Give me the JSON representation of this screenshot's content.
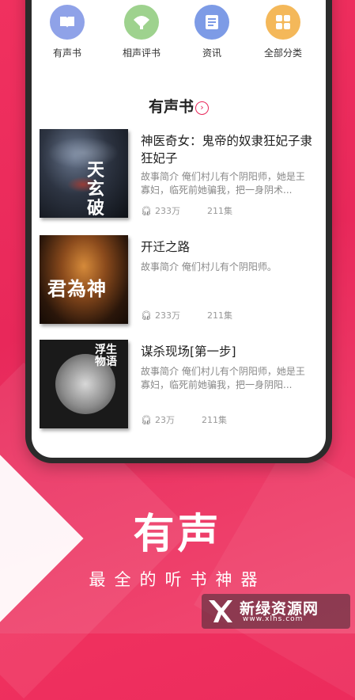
{
  "categories": [
    {
      "label": "有声书",
      "icon": "book-icon",
      "color": "#8fa2e8"
    },
    {
      "label": "相声评书",
      "icon": "fan-icon",
      "color": "#9ed28e"
    },
    {
      "label": "资讯",
      "icon": "news-icon",
      "color": "#7d9be6"
    },
    {
      "label": "全部分类",
      "icon": "grid-icon",
      "color": "#f4b85a"
    }
  ],
  "section": {
    "title": "有声书",
    "more_icon": "chevron-right-icon"
  },
  "books": [
    {
      "title": "神医奇女：鬼帝的奴隶狂妃子隶狂妃子",
      "desc": "故事简介  俺们村儿有个阴阳师，她是王寡妇，临死前她骗我，把一身阴术...",
      "plays": "233万",
      "episodes": "211集",
      "cover_text": "天玄破"
    },
    {
      "title": "开迁之路",
      "desc": "故事简介 俺们村儿有个阴阳师。",
      "plays": "233万",
      "episodes": "211集",
      "cover_text": "君為神"
    },
    {
      "title": "谋杀现场[第一步]",
      "desc": "故事简介  俺们村儿有个阴阳师，她是王寡妇，临死前她骗我，把一身阴阳...",
      "plays": "23万",
      "episodes": "211集",
      "cover_text": "浮生物语"
    }
  ],
  "slogan": {
    "title": "有声",
    "subtitle": "最全的听书神器"
  },
  "watermark": {
    "name": "新绿资源网",
    "url": "www.xlhs.com"
  },
  "colors": {
    "brand": "#e8285a",
    "accent": "#f4b85a"
  }
}
